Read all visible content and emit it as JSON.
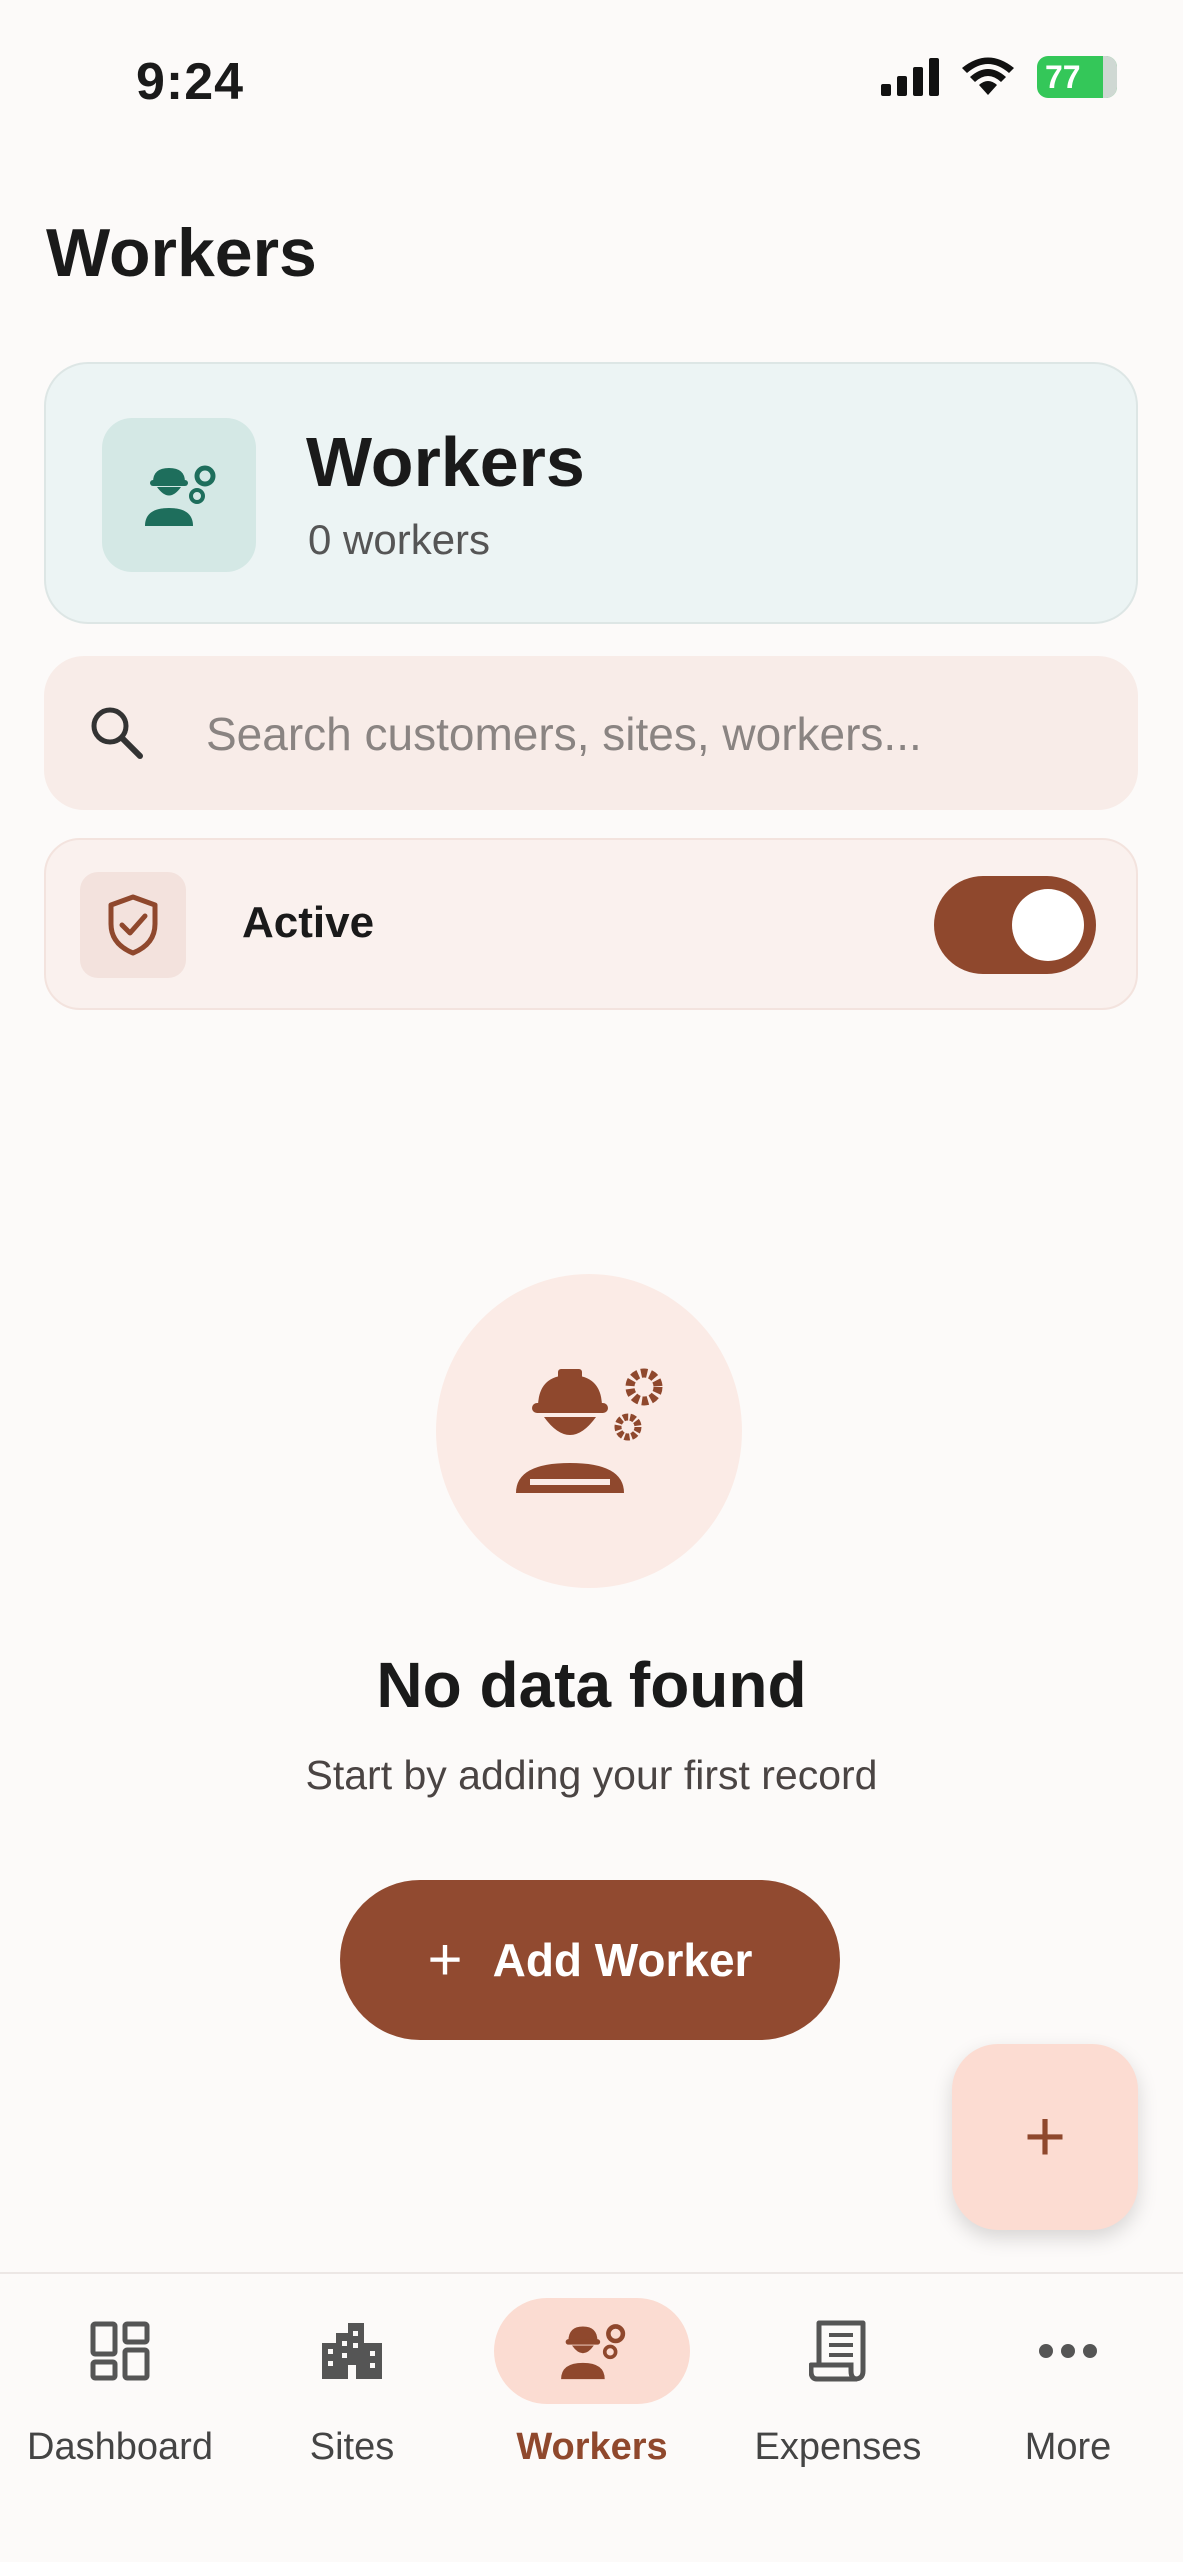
{
  "status_bar": {
    "time": "9:24",
    "battery": "77",
    "battery_color": "#34c759"
  },
  "page": {
    "title": "Workers"
  },
  "header_card": {
    "title": "Workers",
    "count": "0 workers",
    "icon": "worker-gear-icon",
    "accent": "#1e6e5c"
  },
  "search": {
    "placeholder": "Search customers, sites, workers...",
    "value": ""
  },
  "filter": {
    "label": "Active",
    "enabled": true,
    "icon": "shield-check-icon"
  },
  "empty_state": {
    "icon": "worker-gear-icon",
    "title": "No data found",
    "subtitle": "Start by adding your first record",
    "button_label": "Add Worker"
  },
  "fab": {
    "label": "+"
  },
  "brand_color": "#914a30",
  "bottom_nav": {
    "items": [
      {
        "label": "Dashboard",
        "icon": "dashboard-icon",
        "active": false
      },
      {
        "label": "Sites",
        "icon": "building-icon",
        "active": false
      },
      {
        "label": "Workers",
        "icon": "worker-gear-icon",
        "active": true
      },
      {
        "label": "Expenses",
        "icon": "receipt-icon",
        "active": false
      },
      {
        "label": "More",
        "icon": "more-dots-icon",
        "active": false
      }
    ]
  }
}
